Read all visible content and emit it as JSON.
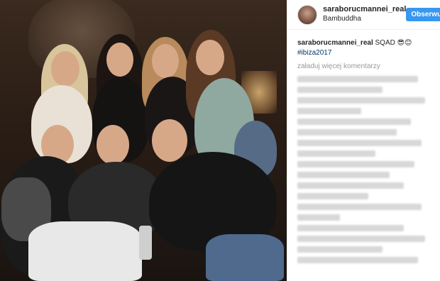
{
  "post": {
    "username": "saraborucmannei_real",
    "location": "Bambuddha",
    "follow_label": "Obserwuj",
    "caption_user": "saraborucmannei_real",
    "caption_text": "SQAD",
    "caption_emoji": "😎😊",
    "hashtag": "#ibiza2017",
    "more_comments_label": "załaduj więcej komentarzy"
  },
  "colors": {
    "accent": "#3897f0",
    "hashtag": "#003569"
  },
  "icons": {
    "avatar": "profile-avatar"
  }
}
